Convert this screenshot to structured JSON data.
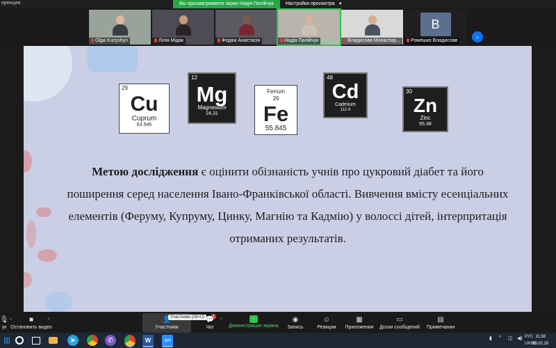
{
  "window": {
    "app_title": "еренция"
  },
  "banner": {
    "share_notice": "Вы просматриваете экран Надія Палійчук",
    "view_options": "Настройки просмотра"
  },
  "participants": [
    {
      "name": "Olga Kuzyshyn"
    },
    {
      "name": "Лілія Мідак"
    },
    {
      "name": "Федюк Анастасія"
    },
    {
      "name": "Надія Палійчук"
    },
    {
      "name": "Владислав Монастир..."
    },
    {
      "name": "Ромешко Владислав",
      "avatar_letter": "В"
    }
  ],
  "slide": {
    "elements": [
      {
        "number": "29",
        "symbol": "Cu",
        "name": "Cuprum",
        "mass": "63.546"
      },
      {
        "number": "12",
        "symbol": "Mg",
        "name": "Magnesium",
        "mass": "24.31"
      },
      {
        "number": "26",
        "symbol": "Fe",
        "name": "Ferrum",
        "mass": "55.845"
      },
      {
        "number": "48",
        "symbol": "Cd",
        "name": "Cadmium",
        "mass": "112.4"
      },
      {
        "number": "30",
        "symbol": "Zn",
        "name": "Zinc",
        "mass": "65.38"
      }
    ],
    "text": {
      "lead": "Метою дослідження",
      "body": " є оцінити обізнаність учнів про цукровий діабет та його поширення серед населення Івано-Франківської області. Вивчення вмісту есенціальних елементів (Феруму, Купруму, Цинку, Магнію та Кадмію) у волоссі дітей, інтерпритація отриманих результатів."
    }
  },
  "toolbar": {
    "left_partial": "ук",
    "stop_video": "Остановить видео",
    "participants_tooltip": "Участники (Alt+U)",
    "participants": "Участники",
    "participants_count": "1",
    "chat": "Чат",
    "screen_share": "Демонстрация экрана",
    "record": "Запись",
    "reactions": "Реакции",
    "apps": "Приложения",
    "whiteboards": "Доски сообщений",
    "notes": "Примечания"
  },
  "taskbar": {
    "zoom_label": "zm",
    "word_label": "W",
    "language": "РУС",
    "layout": "UKRE",
    "time": "11:38",
    "date": "18.02.20"
  }
}
